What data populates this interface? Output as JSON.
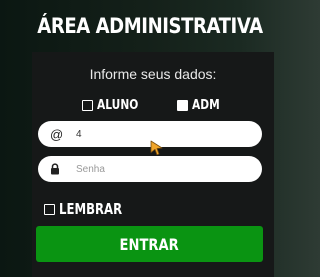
{
  "header": {
    "title": "ÁREA ADMINISTRATIVA"
  },
  "form": {
    "subtitle": "Informe seus dados:",
    "roles": [
      {
        "label": "ALUNO",
        "checked": false
      },
      {
        "label": "ADM",
        "checked": true
      }
    ],
    "user_field": {
      "icon": "at-sign-icon",
      "icon_glyph": "@",
      "value": "4"
    },
    "password_field": {
      "icon": "lock-icon",
      "placeholder": "Senha"
    },
    "remember": {
      "label": "LEMBRAR",
      "checked": false
    },
    "submit_label": "ENTRAR"
  },
  "colors": {
    "primary_button": "#0a9412",
    "cursor": "#f0a52a"
  }
}
